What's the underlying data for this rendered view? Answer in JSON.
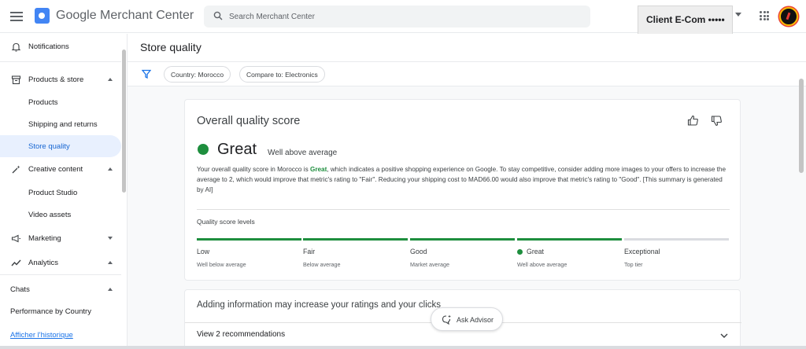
{
  "app": {
    "title_google": "Google",
    "title_product": "Merchant Center"
  },
  "search": {
    "placeholder": "Search Merchant Center"
  },
  "account": {
    "name": "Client E-Com •••••"
  },
  "sidebar": {
    "items": [
      {
        "label": "Notifications"
      },
      {
        "label": "Products & store"
      },
      {
        "label": "Products"
      },
      {
        "label": "Shipping and returns"
      },
      {
        "label": "Store quality"
      },
      {
        "label": "Creative content"
      },
      {
        "label": "Product Studio"
      },
      {
        "label": "Video assets"
      },
      {
        "label": "Marketing"
      },
      {
        "label": "Analytics"
      },
      {
        "label": "Chats"
      },
      {
        "label": "Performance by Country"
      },
      {
        "label": "Afficher l'historique"
      }
    ]
  },
  "page": {
    "title": "Store quality"
  },
  "filters": [
    {
      "label": "Country: Morocco"
    },
    {
      "label": "Compare to: Electronics"
    }
  ],
  "score_card": {
    "title": "Overall quality score",
    "score": "Great",
    "score_sub": "Well above average",
    "summary_pre": "Your overall quality score in Morocco is ",
    "summary_hl": "Great",
    "summary_post": ", which indicates a positive shopping experience on Google. To stay competitive, consider adding more images to your offers to increase the average to 2, which would improve that metric's rating to \"Fair\". Reducing your shipping cost to MAD66.00 would also improve that metric's rating to \"Good\". [This summary is generated by AI]",
    "levels_title": "Quality score levels",
    "levels": [
      {
        "name": "Low",
        "desc": "Well below average"
      },
      {
        "name": "Fair",
        "desc": "Below average"
      },
      {
        "name": "Good",
        "desc": "Market average"
      },
      {
        "name": "Great",
        "desc": "Well above average"
      },
      {
        "name": "Exceptional",
        "desc": "Top tier"
      }
    ],
    "current_level": "Great",
    "accent": "#1e8e3e"
  },
  "info_card": {
    "title": "Adding information may increase your ratings and your clicks",
    "recommendations": "View 2 recommendations"
  },
  "advisor": {
    "label": "Ask Advisor"
  }
}
